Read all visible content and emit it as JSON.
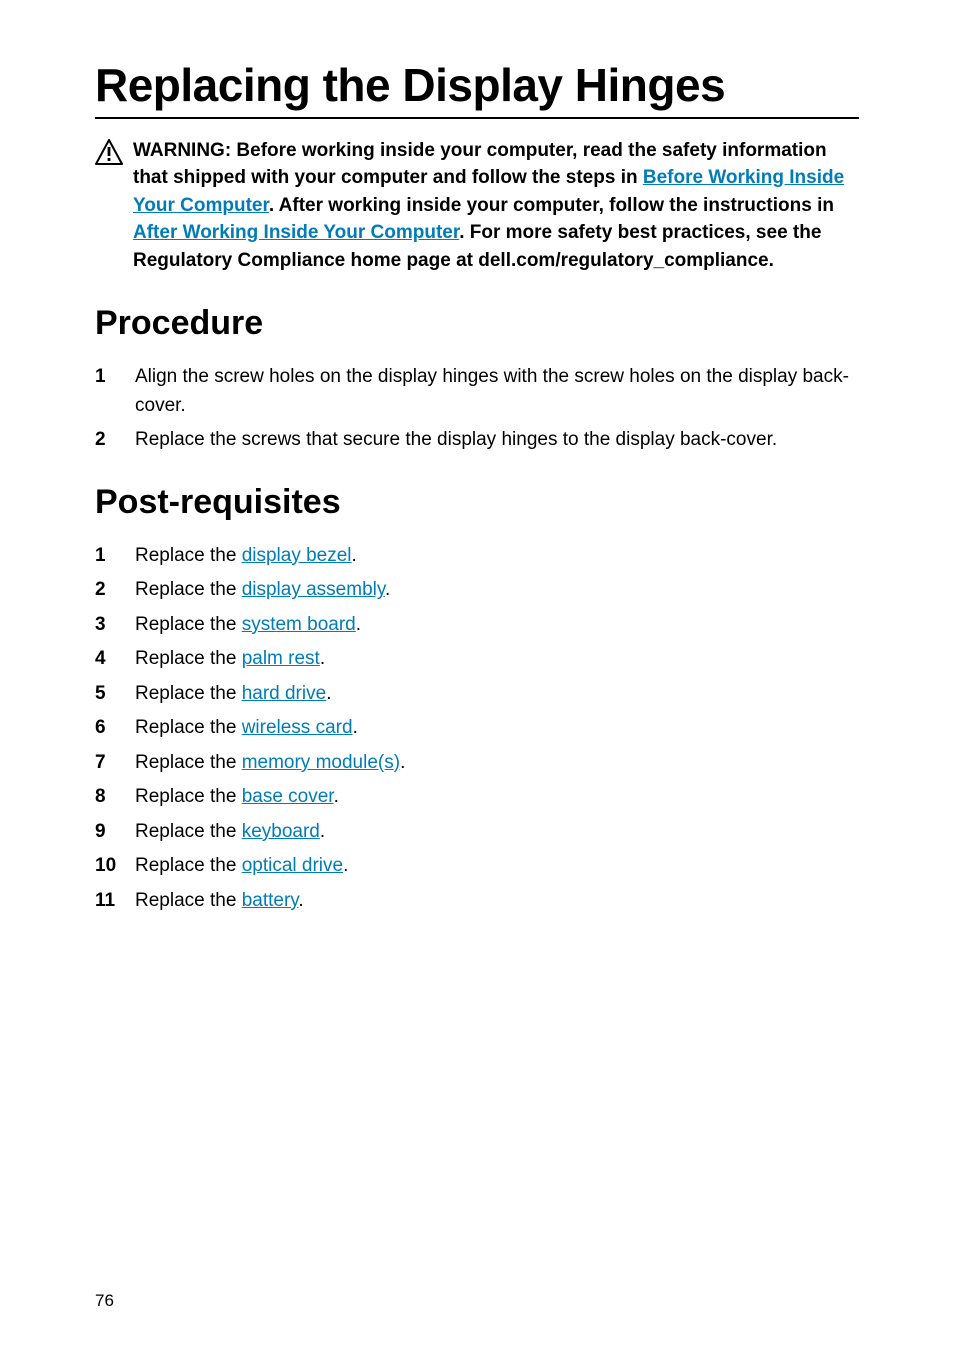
{
  "title": "Replacing the Display Hinges",
  "warning": {
    "prefix": "WARNING: Before working inside your computer, read the safety information that shipped with your computer and follow the steps in ",
    "link1": "Before Working Inside Your Computer",
    "mid1": ". After working inside your computer, follow the instructions in ",
    "link2": "After Working Inside Your Computer",
    "suffix": ". For more safety best practices, see the Regulatory Compliance home page at dell.com/regulatory_compliance."
  },
  "sections": {
    "procedure_heading": "Procedure",
    "postreq_heading": "Post-requisites"
  },
  "procedure": [
    {
      "num": "1",
      "text": "Align the screw holes on the display hinges with the screw holes on the display back-cover."
    },
    {
      "num": "2",
      "text": "Replace the screws that secure the display hinges to the display back-cover."
    }
  ],
  "postreq": [
    {
      "num": "1",
      "prefix": "Replace the ",
      "link": "display bezel",
      "suffix": "."
    },
    {
      "num": "2",
      "prefix": "Replace the ",
      "link": "display assembly",
      "suffix": "."
    },
    {
      "num": "3",
      "prefix": "Replace the ",
      "link": "system board",
      "suffix": "."
    },
    {
      "num": "4",
      "prefix": "Replace the ",
      "link": "palm rest",
      "suffix": "."
    },
    {
      "num": "5",
      "prefix": "Replace the ",
      "link": "hard drive",
      "suffix": "."
    },
    {
      "num": "6",
      "prefix": "Replace the ",
      "link": "wireless card",
      "suffix": "."
    },
    {
      "num": "7",
      "prefix": "Replace the ",
      "link": "memory module(s)",
      "suffix": "."
    },
    {
      "num": "8",
      "prefix": "Replace the ",
      "link": "base cover",
      "suffix": "."
    },
    {
      "num": "9",
      "prefix": "Replace the ",
      "link": "keyboard",
      "suffix": "."
    },
    {
      "num": "10",
      "prefix": "Replace the ",
      "link": "optical drive",
      "suffix": "."
    },
    {
      "num": "11",
      "prefix": "Replace the ",
      "link": "battery",
      "suffix": "."
    }
  ],
  "page_number": "76"
}
